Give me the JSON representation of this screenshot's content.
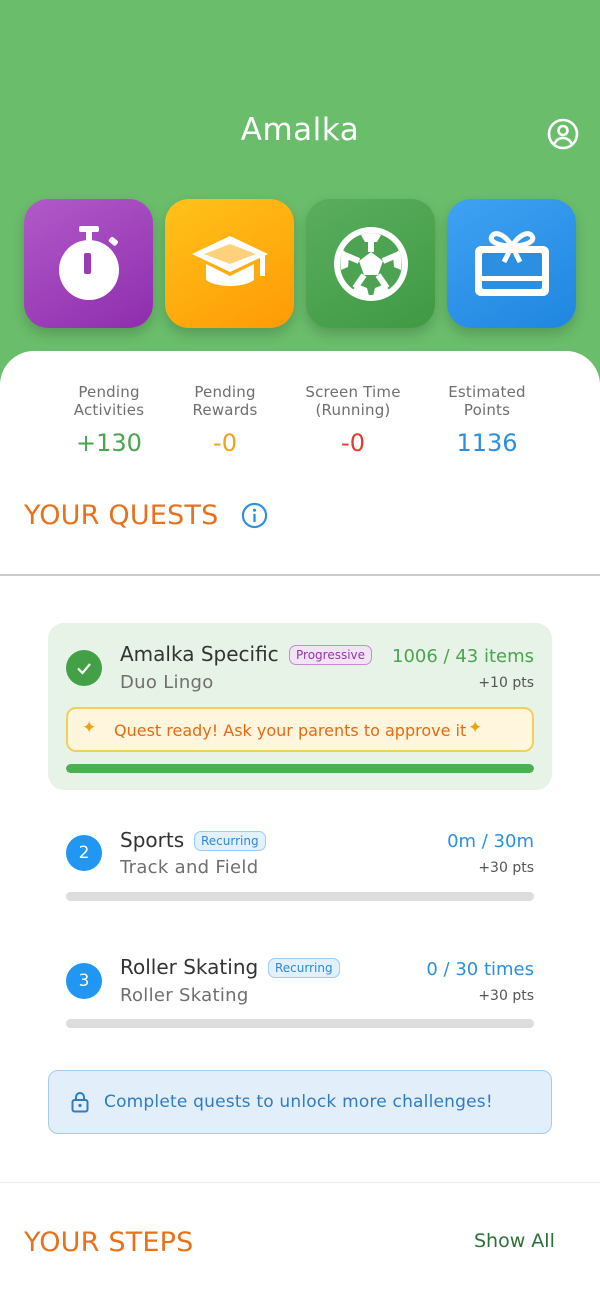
{
  "header": {
    "title": "Amalka"
  },
  "tiles": [
    {
      "name": "timer",
      "color": "#9b3cb7"
    },
    {
      "name": "education",
      "color": "#ffab0f"
    },
    {
      "name": "sports",
      "color": "#4ea352"
    },
    {
      "name": "rewards",
      "color": "#2d8fe0"
    }
  ],
  "stats": [
    {
      "label": "Pending\nActivities",
      "value": "+130",
      "color": "#4aa450"
    },
    {
      "label": "Pending\nRewards",
      "value": "-0",
      "color": "#f5a01a"
    },
    {
      "label": "Screen Time\n(Running)",
      "value": "-0",
      "color": "#e53935"
    },
    {
      "label": "Estimated\nPoints",
      "value": "1136",
      "color": "#2d8fe0"
    }
  ],
  "quests": {
    "title": "YOUR QUESTS",
    "items": [
      {
        "name": "Amalka Specific",
        "badge": "Progressive",
        "subtitle": "Duo Lingo",
        "progress_text": "1006 / 43 items",
        "points": "+10 pts",
        "progress": 1.0,
        "status": "completed",
        "banner": "Quest ready! Ask your parents to approve it"
      },
      {
        "number": "2",
        "name": "Sports",
        "badge": "Recurring",
        "subtitle": "Track and Field",
        "progress_text": "0m / 30m",
        "points": "+30 pts",
        "progress": 0.0
      },
      {
        "number": "3",
        "name": "Roller Skating",
        "badge": "Recurring",
        "subtitle": "Roller Skating",
        "progress_text": "0 / 30 times",
        "points": "+30 pts",
        "progress": 0.0
      }
    ],
    "lock_message": "Complete quests to unlock more challenges!"
  },
  "steps": {
    "title": "YOUR STEPS",
    "show_all": "Show All"
  }
}
